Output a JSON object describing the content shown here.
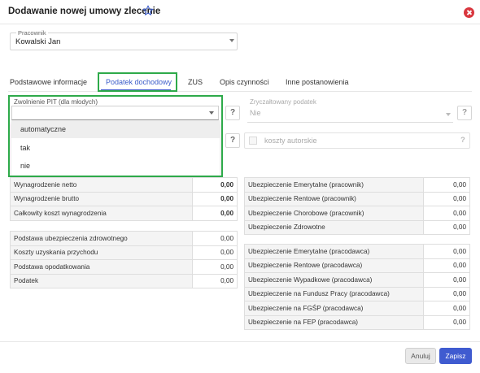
{
  "dialog": {
    "title": "Dodawanie nowej umowy zlecenie",
    "close_icon": "close-icon",
    "favorite_icon": "star-outline-icon",
    "accent_color": "#3b5cc9",
    "highlight_color": "#2eaa4a"
  },
  "employee": {
    "label": "Pracownik",
    "value": "Kowalski Jan"
  },
  "tabs": [
    {
      "label": "Podstawowe informacje",
      "active": false
    },
    {
      "label": "Podatek dochodowy",
      "active": true
    },
    {
      "label": "ZUS",
      "active": false
    },
    {
      "label": "Opis czynności",
      "active": false
    },
    {
      "label": "Inne postanowienia",
      "active": false
    }
  ],
  "pit": {
    "label": "Zwolnienie PIT (dla młodych)",
    "value": "",
    "options": [
      "automatyczne",
      "tak",
      "nie"
    ],
    "help": "?"
  },
  "flat_tax": {
    "label": "Zryczałtowany podatek",
    "value": "Nie",
    "help": "?"
  },
  "second_row": {
    "help": "?"
  },
  "author_costs": {
    "label": "koszty autorskie",
    "checked": false,
    "help": "?"
  },
  "left_table_1": [
    {
      "label": "Wynagrodzenie netto",
      "value": "0,00"
    },
    {
      "label": "Wynagrodzenie brutto",
      "value": "0,00"
    },
    {
      "label": "Całkowity koszt wynagrodzenia",
      "value": "0,00"
    }
  ],
  "left_table_2": [
    {
      "label": "Podstawa ubezpieczenia zdrowotnego",
      "value": "0,00"
    },
    {
      "label": "Koszty uzyskania przychodu",
      "value": "0,00"
    },
    {
      "label": "Podstawa opodatkowania",
      "value": "0,00"
    },
    {
      "label": "Podatek",
      "value": "0,00"
    }
  ],
  "right_table_1": [
    {
      "label": "Ubezpieczenie Emerytalne (pracownik)",
      "value": "0,00"
    },
    {
      "label": "Ubezpieczenie Rentowe (pracownik)",
      "value": "0,00"
    },
    {
      "label": "Ubezpieczenie Chorobowe (pracownik)",
      "value": "0,00"
    },
    {
      "label": "Ubezpieczenie Zdrowotne",
      "value": "0,00"
    }
  ],
  "right_table_2": [
    {
      "label": "Ubezpieczenie Emerytalne (pracodawca)",
      "value": "0,00"
    },
    {
      "label": "Ubezpieczenie Rentowe (pracodawca)",
      "value": "0,00"
    },
    {
      "label": "Ubezpieczenie Wypadkowe (pracodawca)",
      "value": "0,00"
    },
    {
      "label": "Ubezpieczenie na Fundusz Pracy (pracodawca)",
      "value": "0,00"
    },
    {
      "label": "Ubezpieczenie na FGŚP (pracodawca)",
      "value": "0,00"
    },
    {
      "label": "Ubezpieczenie na FEP (pracodawca)",
      "value": "0,00"
    }
  ],
  "footer": {
    "cancel_label": "Anuluj",
    "save_label": "Zapisz"
  }
}
